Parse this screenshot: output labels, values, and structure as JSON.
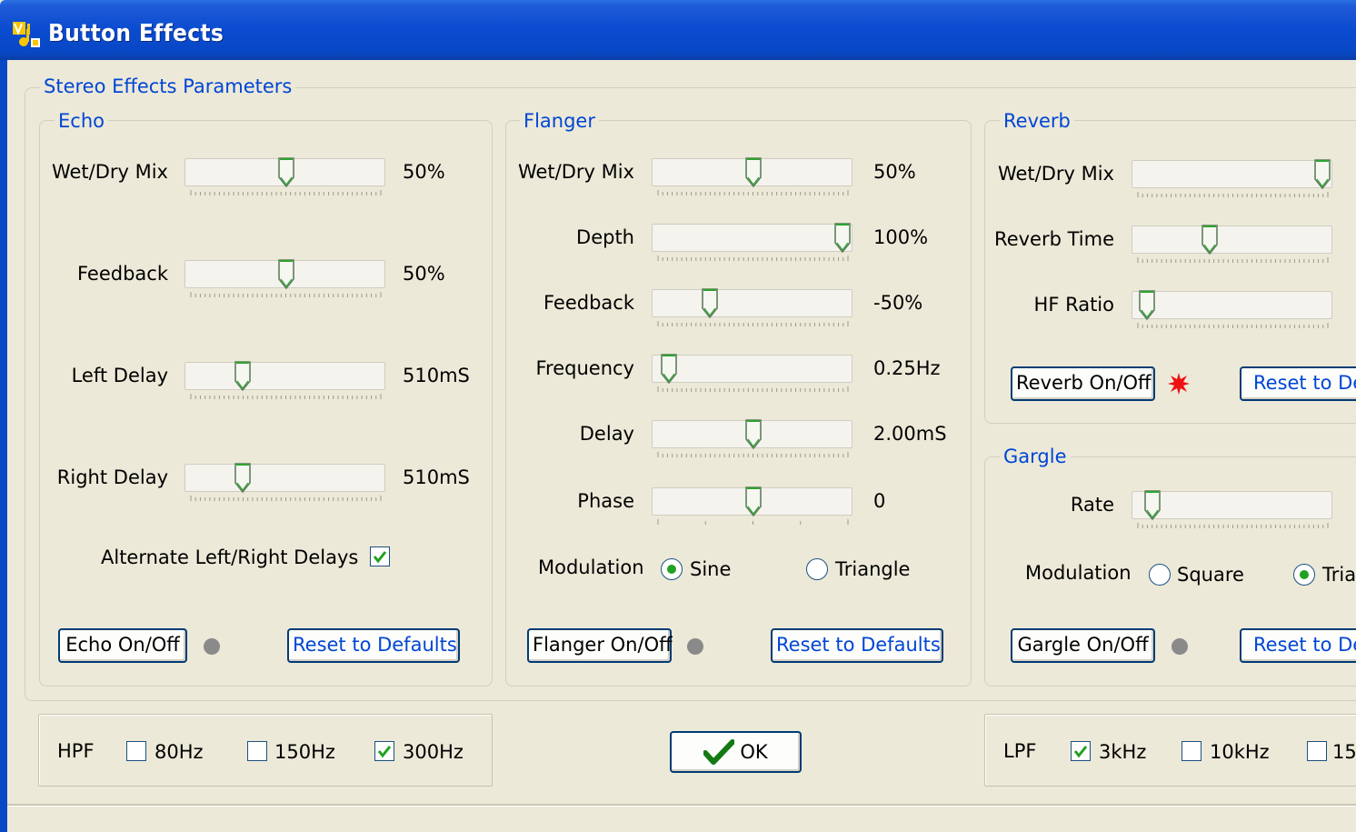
{
  "window": {
    "title": "Button Effects"
  },
  "stereo_group": {
    "title": "Stereo Effects Parameters"
  },
  "echo": {
    "title": "Echo",
    "params": [
      {
        "label": "Wet/Dry Mix",
        "value": "50%",
        "level": 0.5
      },
      {
        "label": "Feedback",
        "value": "50%",
        "level": 0.5
      },
      {
        "label": "Left Delay",
        "value": "510mS",
        "level": 0.26
      },
      {
        "label": "Right Delay",
        "value": "510mS",
        "level": 0.26
      }
    ],
    "alternate_label": "Alternate Left/Right Delays",
    "alternate_checked": true,
    "onoff_label": "Echo On/Off",
    "reset_label": "Reset to Defaults",
    "led_color": "#8A8A8A"
  },
  "flanger": {
    "title": "Flanger",
    "params": [
      {
        "label": "Wet/Dry Mix",
        "value": "50%",
        "level": 0.5
      },
      {
        "label": "Depth",
        "value": "100%",
        "level": 1.0
      },
      {
        "label": "Feedback",
        "value": "-50%",
        "level": 0.26
      },
      {
        "label": "Frequency",
        "value": "0.25Hz",
        "level": 0.03
      },
      {
        "label": "Delay",
        "value": "2.00mS",
        "level": 0.5
      },
      {
        "label": "Phase",
        "value": "0",
        "level": 0.5
      }
    ],
    "modulation_label": "Modulation",
    "modulation_options": [
      "Sine",
      "Triangle"
    ],
    "modulation_selected": "Sine",
    "onoff_label": "Flanger On/Off",
    "reset_label": "Reset to Defaults",
    "led_color": "#8A8A8A"
  },
  "reverb": {
    "title": "Reverb",
    "params": [
      {
        "label": "Wet/Dry Mix",
        "level": 1.0
      },
      {
        "label": "Reverb Time",
        "level": 0.37
      },
      {
        "label": "HF Ratio",
        "level": 0.02
      }
    ],
    "onoff_label": "Reverb On/Off",
    "reset_label": "Reset to De",
    "led_color": "#EE1111"
  },
  "gargle": {
    "title": "Gargle",
    "params": [
      {
        "label": "Rate",
        "level": 0.05
      }
    ],
    "modulation_label": "Modulation",
    "modulation_options": [
      "Square",
      "Tria"
    ],
    "modulation_selected": "Tria",
    "onoff_label": "Gargle On/Off",
    "reset_label": "Reset to De",
    "led_color": "#8A8A8A"
  },
  "hpf": {
    "label": "HPF",
    "options": [
      {
        "label": "80Hz",
        "checked": false
      },
      {
        "label": "150Hz",
        "checked": false
      },
      {
        "label": "300Hz",
        "checked": true
      }
    ]
  },
  "ok_button": {
    "label": "OK"
  },
  "lpf": {
    "label": "LPF",
    "options": [
      {
        "label": "3kHz",
        "checked": true
      },
      {
        "label": "10kHz",
        "checked": false
      },
      {
        "label": "15",
        "checked": false
      }
    ]
  },
  "colors": {
    "accent": "#0046D5",
    "titlebar": "#0A4BD0",
    "face": "#ECE9D8",
    "check": "#21A121"
  }
}
